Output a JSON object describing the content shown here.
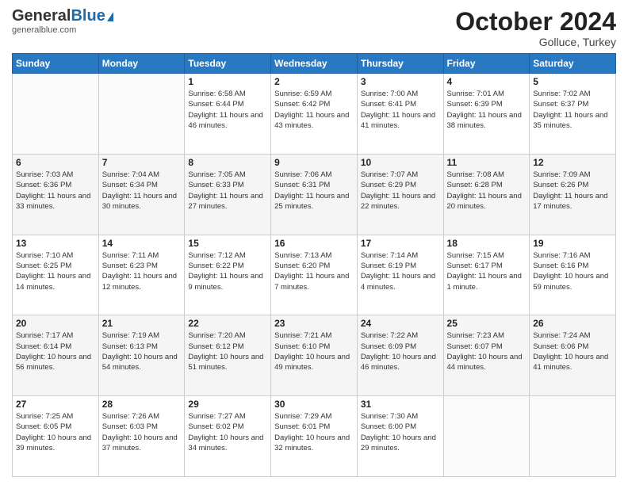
{
  "logo": {
    "general": "General",
    "blue": "Blue",
    "tagline": "generalblue.com"
  },
  "title": "October 2024",
  "location": "Golluce, Turkey",
  "days_of_week": [
    "Sunday",
    "Monday",
    "Tuesday",
    "Wednesday",
    "Thursday",
    "Friday",
    "Saturday"
  ],
  "weeks": [
    [
      {
        "day": "",
        "info": ""
      },
      {
        "day": "",
        "info": ""
      },
      {
        "day": "1",
        "info": "Sunrise: 6:58 AM\nSunset: 6:44 PM\nDaylight: 11 hours and 46 minutes."
      },
      {
        "day": "2",
        "info": "Sunrise: 6:59 AM\nSunset: 6:42 PM\nDaylight: 11 hours and 43 minutes."
      },
      {
        "day": "3",
        "info": "Sunrise: 7:00 AM\nSunset: 6:41 PM\nDaylight: 11 hours and 41 minutes."
      },
      {
        "day": "4",
        "info": "Sunrise: 7:01 AM\nSunset: 6:39 PM\nDaylight: 11 hours and 38 minutes."
      },
      {
        "day": "5",
        "info": "Sunrise: 7:02 AM\nSunset: 6:37 PM\nDaylight: 11 hours and 35 minutes."
      }
    ],
    [
      {
        "day": "6",
        "info": "Sunrise: 7:03 AM\nSunset: 6:36 PM\nDaylight: 11 hours and 33 minutes."
      },
      {
        "day": "7",
        "info": "Sunrise: 7:04 AM\nSunset: 6:34 PM\nDaylight: 11 hours and 30 minutes."
      },
      {
        "day": "8",
        "info": "Sunrise: 7:05 AM\nSunset: 6:33 PM\nDaylight: 11 hours and 27 minutes."
      },
      {
        "day": "9",
        "info": "Sunrise: 7:06 AM\nSunset: 6:31 PM\nDaylight: 11 hours and 25 minutes."
      },
      {
        "day": "10",
        "info": "Sunrise: 7:07 AM\nSunset: 6:29 PM\nDaylight: 11 hours and 22 minutes."
      },
      {
        "day": "11",
        "info": "Sunrise: 7:08 AM\nSunset: 6:28 PM\nDaylight: 11 hours and 20 minutes."
      },
      {
        "day": "12",
        "info": "Sunrise: 7:09 AM\nSunset: 6:26 PM\nDaylight: 11 hours and 17 minutes."
      }
    ],
    [
      {
        "day": "13",
        "info": "Sunrise: 7:10 AM\nSunset: 6:25 PM\nDaylight: 11 hours and 14 minutes."
      },
      {
        "day": "14",
        "info": "Sunrise: 7:11 AM\nSunset: 6:23 PM\nDaylight: 11 hours and 12 minutes."
      },
      {
        "day": "15",
        "info": "Sunrise: 7:12 AM\nSunset: 6:22 PM\nDaylight: 11 hours and 9 minutes."
      },
      {
        "day": "16",
        "info": "Sunrise: 7:13 AM\nSunset: 6:20 PM\nDaylight: 11 hours and 7 minutes."
      },
      {
        "day": "17",
        "info": "Sunrise: 7:14 AM\nSunset: 6:19 PM\nDaylight: 11 hours and 4 minutes."
      },
      {
        "day": "18",
        "info": "Sunrise: 7:15 AM\nSunset: 6:17 PM\nDaylight: 11 hours and 1 minute."
      },
      {
        "day": "19",
        "info": "Sunrise: 7:16 AM\nSunset: 6:16 PM\nDaylight: 10 hours and 59 minutes."
      }
    ],
    [
      {
        "day": "20",
        "info": "Sunrise: 7:17 AM\nSunset: 6:14 PM\nDaylight: 10 hours and 56 minutes."
      },
      {
        "day": "21",
        "info": "Sunrise: 7:19 AM\nSunset: 6:13 PM\nDaylight: 10 hours and 54 minutes."
      },
      {
        "day": "22",
        "info": "Sunrise: 7:20 AM\nSunset: 6:12 PM\nDaylight: 10 hours and 51 minutes."
      },
      {
        "day": "23",
        "info": "Sunrise: 7:21 AM\nSunset: 6:10 PM\nDaylight: 10 hours and 49 minutes."
      },
      {
        "day": "24",
        "info": "Sunrise: 7:22 AM\nSunset: 6:09 PM\nDaylight: 10 hours and 46 minutes."
      },
      {
        "day": "25",
        "info": "Sunrise: 7:23 AM\nSunset: 6:07 PM\nDaylight: 10 hours and 44 minutes."
      },
      {
        "day": "26",
        "info": "Sunrise: 7:24 AM\nSunset: 6:06 PM\nDaylight: 10 hours and 41 minutes."
      }
    ],
    [
      {
        "day": "27",
        "info": "Sunrise: 7:25 AM\nSunset: 6:05 PM\nDaylight: 10 hours and 39 minutes."
      },
      {
        "day": "28",
        "info": "Sunrise: 7:26 AM\nSunset: 6:03 PM\nDaylight: 10 hours and 37 minutes."
      },
      {
        "day": "29",
        "info": "Sunrise: 7:27 AM\nSunset: 6:02 PM\nDaylight: 10 hours and 34 minutes."
      },
      {
        "day": "30",
        "info": "Sunrise: 7:29 AM\nSunset: 6:01 PM\nDaylight: 10 hours and 32 minutes."
      },
      {
        "day": "31",
        "info": "Sunrise: 7:30 AM\nSunset: 6:00 PM\nDaylight: 10 hours and 29 minutes."
      },
      {
        "day": "",
        "info": ""
      },
      {
        "day": "",
        "info": ""
      }
    ]
  ]
}
